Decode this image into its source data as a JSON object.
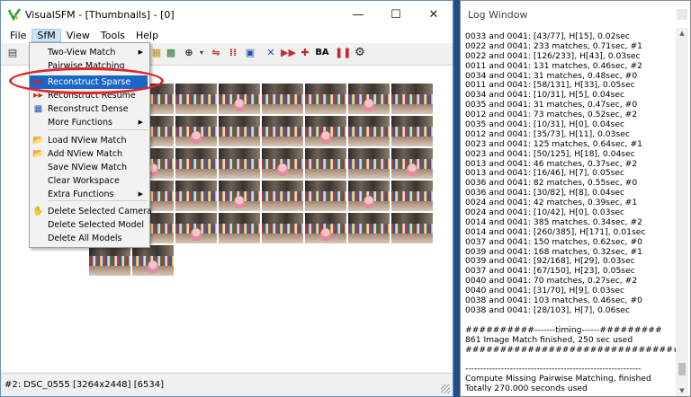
{
  "main_window": {
    "title": "VisualSFM - [Thumbnails] - [0]",
    "controls": {
      "minimize": "—",
      "maximize": "☐",
      "close": "✕"
    },
    "menubar": [
      {
        "name": "menu-file",
        "label": "File"
      },
      {
        "name": "menu-sfm",
        "label": "SfM"
      },
      {
        "name": "menu-view",
        "label": "View"
      },
      {
        "name": "menu-tools",
        "label": "Tools"
      },
      {
        "name": "menu-help",
        "label": "Help"
      }
    ],
    "toolbar": {
      "ba_label": "BA"
    },
    "status": "#2: DSC_0555 [3264x2448] [6534]"
  },
  "sfm_menu": {
    "items": [
      {
        "label": "Two-View Match",
        "submenu": true,
        "icon": ""
      },
      {
        "label": "Pairwise Matching",
        "submenu": false,
        "icon": ""
      },
      {
        "label": "Reconstruct Sparse",
        "submenu": false,
        "icon": "▶▶",
        "highlighted": true
      },
      {
        "label": "Reconstruct Resume",
        "submenu": false,
        "icon": "▶▶"
      },
      {
        "label": "Reconstruct Dense",
        "submenu": false,
        "icon": "▦"
      },
      {
        "label": "More Functions",
        "submenu": true,
        "icon": ""
      },
      {
        "label": "Load NView Match",
        "submenu": false,
        "icon": "📂"
      },
      {
        "label": "Add  NView Match",
        "submenu": false,
        "icon": "📂"
      },
      {
        "label": "Save NView Match",
        "submenu": false,
        "icon": ""
      },
      {
        "label": "Clear Workspace",
        "submenu": false,
        "icon": ""
      },
      {
        "label": "Extra Functions",
        "submenu": true,
        "icon": ""
      },
      {
        "label": "Delete Selected Camera",
        "submenu": false,
        "icon": "✋"
      },
      {
        "label": "Delete Selected Model",
        "submenu": false,
        "icon": ""
      },
      {
        "label": "Delete All Models",
        "submenu": false,
        "icon": ""
      }
    ]
  },
  "log_window": {
    "title": "Log Window",
    "lines": [
      "0033 and 0041: [43/77], H[15], 0.02sec",
      "0022 and 0041: 233 matches, 0.71sec, #1",
      "0022 and 0041: [126/233], H[43], 0.03sec",
      "0011 and 0041: 131 matches, 0.46sec, #2",
      "0034 and 0041: 31 matches, 0.48sec, #0",
      "0011 and 0041: [58/131], H[33], 0.05sec",
      "0034 and 0041: [10/31], H[5], 0.04sec",
      "0035 and 0041: 31 matches, 0.47sec, #0",
      "0012 and 0041: 73 matches, 0.52sec, #2",
      "0035 and 0041: [10/31], H[0], 0.04sec",
      "0012 and 0041: [35/73], H[11], 0.03sec",
      "0023 and 0041: 125 matches, 0.64sec, #1",
      "0023 and 0041: [50/125], H[18], 0.04sec",
      "0013 and 0041: 46 matches, 0.37sec, #2",
      "0013 and 0041: [16/46], H[7], 0.05sec",
      "0036 and 0041: 82 matches, 0.55sec, #0",
      "0036 and 0041: [30/82], H[8], 0.04sec",
      "0024 and 0041: 42 matches, 0.39sec, #1",
      "0024 and 0041: [10/42], H[0], 0.03sec",
      "0014 and 0041: 385 matches, 0.34sec, #2",
      "0014 and 0041: [260/385], H[171], 0.01sec",
      "0037 and 0041: 150 matches, 0.62sec, #0",
      "0039 and 0041: 168 matches, 0.32sec, #1",
      "0039 and 0041: [92/168], H[29], 0.03sec",
      "0037 and 0041: [67/150], H[23], 0.05sec",
      "0040 and 0041: 70 matches, 0.27sec, #2",
      "0040 and 0041: [31/70], H[9], 0.03sec",
      "0038 and 0041: 103 matches, 0.46sec, #0",
      "0038 and 0041: [28/103], H[7], 0.06sec",
      "",
      "##########-------timing------#########",
      "861 Image Match finished, 250 sec used",
      "#################################",
      "",
      "-----------------------------------------------------------",
      "Compute Missing Pairwise Matching, finished",
      "Totally 270.000 seconds used"
    ]
  }
}
